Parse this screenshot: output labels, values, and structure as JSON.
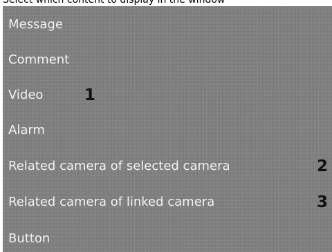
{
  "top_clip_text": "Select which content to display in the window",
  "menu": {
    "items": [
      {
        "label": "Message"
      },
      {
        "label": "Comment"
      },
      {
        "label": "Video"
      },
      {
        "label": "Alarm"
      },
      {
        "label": "Related camera of selected camera"
      },
      {
        "label": "Related camera of linked camera"
      },
      {
        "label": "Button"
      }
    ]
  },
  "callouts": [
    "1",
    "2",
    "3"
  ],
  "colors": {
    "panel_background": "#808080",
    "item_text": "#f2f2f2",
    "callout_text": "#111111"
  }
}
